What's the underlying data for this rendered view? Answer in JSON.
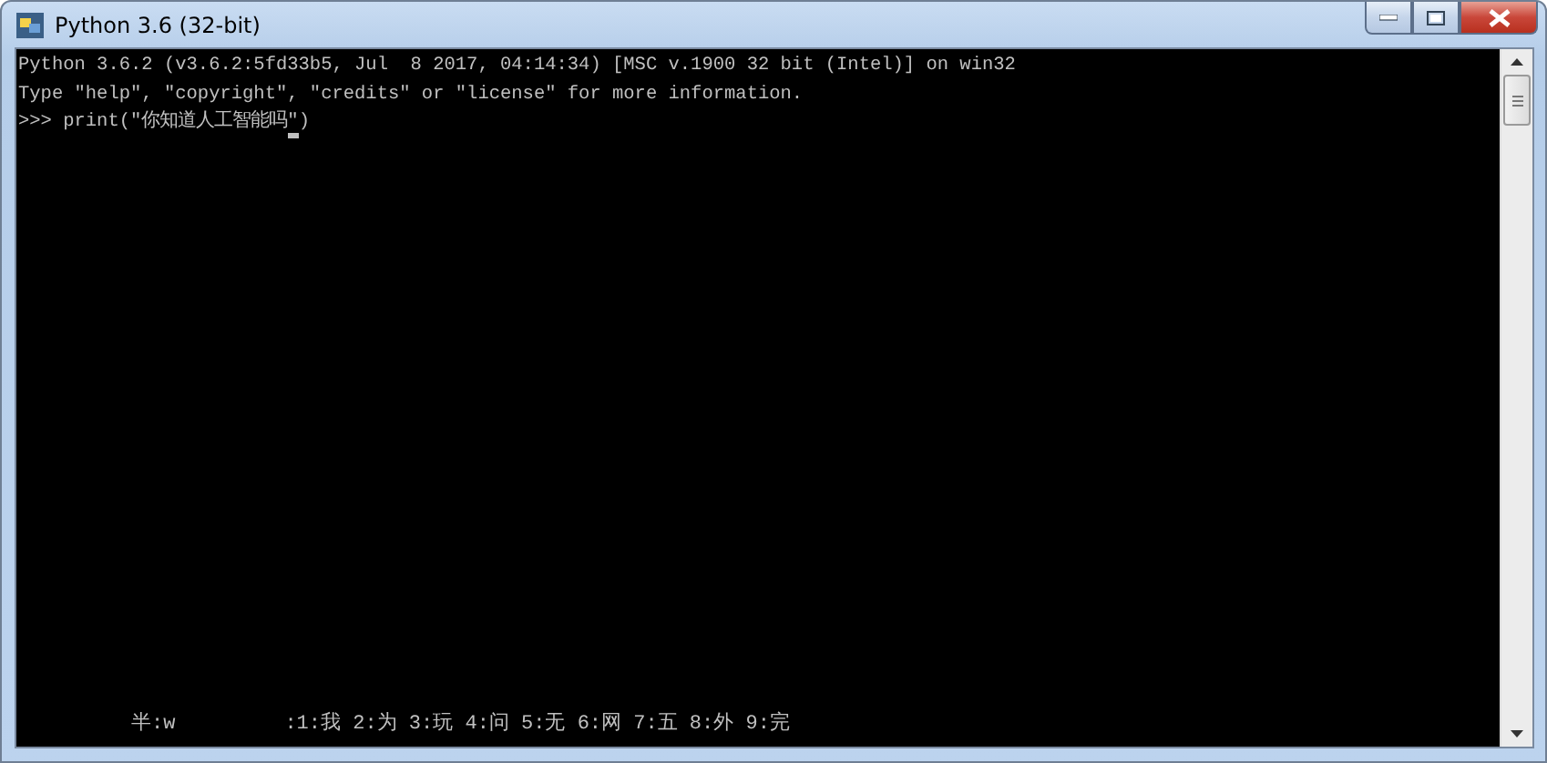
{
  "window": {
    "title": "Python 3.6 (32-bit)"
  },
  "console": {
    "lines": [
      "Python 3.6.2 (v3.6.2:5fd33b5, Jul  8 2017, 04:14:34) [MSC v.1900 32 bit (Intel)] on win32",
      "Type \"help\", \"copyright\", \"credits\" or \"license\" for more information."
    ],
    "prompt": ">>> ",
    "input_before_cursor": "print(\"你知道人工智能吗",
    "input_at_cursor": "\"",
    "input_after_cursor": ")"
  },
  "ime": {
    "mode": "半:w",
    "candidates": ":1:我 2:为 3:玩 4:问 5:无 6:网 7:五 8:外 9:完"
  }
}
